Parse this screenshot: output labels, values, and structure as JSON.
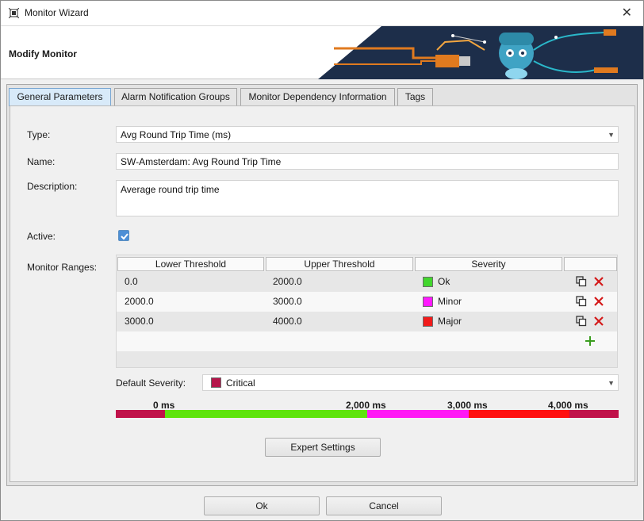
{
  "window": {
    "title": "Monitor Wizard",
    "close_glyph": "✕"
  },
  "banner": {
    "title": "Modify Monitor"
  },
  "tabs": [
    {
      "label": "General Parameters",
      "active": true
    },
    {
      "label": "Alarm Notification Groups",
      "active": false
    },
    {
      "label": "Monitor Dependency Information",
      "active": false
    },
    {
      "label": "Tags",
      "active": false
    }
  ],
  "form": {
    "type_label": "Type:",
    "type_value": "Avg Round Trip Time (ms)",
    "name_label": "Name:",
    "name_value": "SW-Amsterdam: Avg Round Trip Time",
    "description_label": "Description:",
    "description_value": "Average round trip time",
    "active_label": "Active:",
    "active_checked": true,
    "ranges_label": "Monitor Ranges:",
    "default_severity_label": "Default Severity:",
    "default_severity_value": "Critical",
    "default_severity_color": "#b5164b"
  },
  "ranges": {
    "headers": [
      "Lower Threshold",
      "Upper Threshold",
      "Severity",
      ""
    ],
    "rows": [
      {
        "lower": "0.0",
        "upper": "2000.0",
        "severity": "Ok",
        "color": "#42d62d"
      },
      {
        "lower": "2000.0",
        "upper": "3000.0",
        "severity": "Minor",
        "color": "#ff19ff"
      },
      {
        "lower": "3000.0",
        "upper": "4000.0",
        "severity": "Major",
        "color": "#f11b1b"
      }
    ],
    "add_glyph": "+"
  },
  "scale": {
    "labels": [
      "0 ms",
      "2,000 ms",
      "3,000 ms",
      "4,000 ms"
    ],
    "colors": {
      "critical": "#c0124a",
      "ok": "#5fe40d",
      "minor": "#ff19f5",
      "major": "#ff1010"
    }
  },
  "buttons": {
    "expert": "Expert Settings",
    "ok": "Ok",
    "cancel": "Cancel"
  },
  "icons": {
    "app": "monitor-wizard-icon",
    "copy": "copy-icon",
    "delete": "delete-icon",
    "add": "add-icon",
    "check": "checkmark-icon"
  }
}
